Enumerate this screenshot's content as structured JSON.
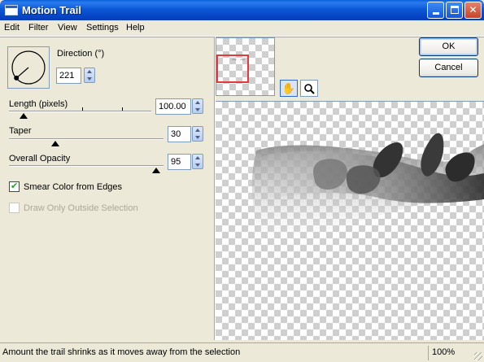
{
  "window": {
    "title": "Motion Trail"
  },
  "menu": {
    "items": [
      "Edit",
      "Filter",
      "View",
      "Settings",
      "Help"
    ]
  },
  "direction": {
    "label": "Direction (°)",
    "value": "221"
  },
  "length": {
    "label": "Length (pixels)",
    "value": "100.00",
    "level": 0.1
  },
  "taper": {
    "label": "Taper",
    "value": "30",
    "level": 0.3
  },
  "opacity": {
    "label": "Overall Opacity",
    "value": "95",
    "level": 0.95
  },
  "options": {
    "smear": {
      "label": "Smear Color from Edges",
      "checked": true
    },
    "draw_outside": {
      "label": "Draw Only Outside Selection",
      "checked": false,
      "enabled": false
    }
  },
  "buttons": {
    "ok": "OK",
    "cancel": "Cancel"
  },
  "tools": {
    "pan": "pan-hand-icon",
    "zoom": "zoom-magnifier-icon"
  },
  "status": {
    "message": "Amount the trail shrinks as it moves away from the selection",
    "zoom": "100%"
  },
  "colors": {
    "title_bar": "#0a5fd8",
    "selection_rect": "#e23b3b",
    "dialog_bg": "#ece9d8"
  }
}
